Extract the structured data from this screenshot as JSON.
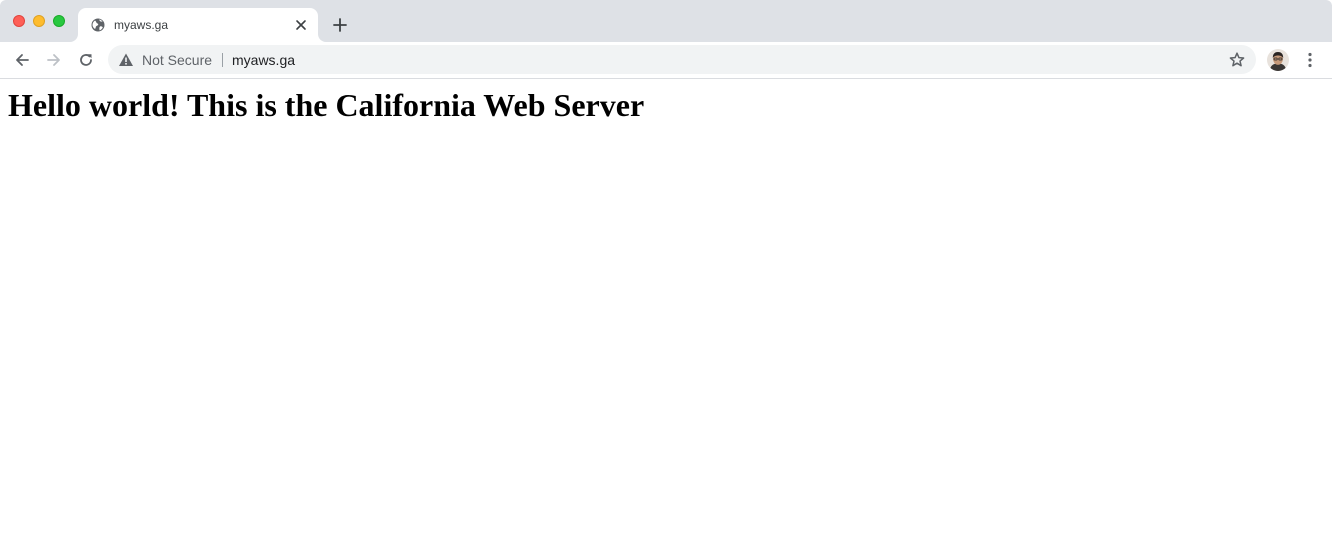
{
  "window": {
    "traffic_lights": {
      "close_color": "#fe5f57",
      "minimize_color": "#febc2e",
      "maximize_color": "#28c840"
    }
  },
  "tabs": [
    {
      "title": "myaws.ga",
      "favicon": "globe-icon",
      "active": true
    }
  ],
  "toolbar": {
    "back_icon": "arrow-left-icon",
    "forward_icon": "arrow-right-icon",
    "reload_icon": "reload-icon",
    "new_tab_icon": "plus-icon",
    "close_tab_icon": "close-icon"
  },
  "omnibox": {
    "security_icon": "warning-triangle-icon",
    "security_label": "Not Secure",
    "url": "myaws.ga",
    "bookmark_icon": "star-outline-icon"
  },
  "profile": {
    "avatar_icon": "avatar-icon"
  },
  "menu": {
    "icon": "more-vertical-icon"
  },
  "page": {
    "heading": "Hello world! This is the California Web Server"
  }
}
